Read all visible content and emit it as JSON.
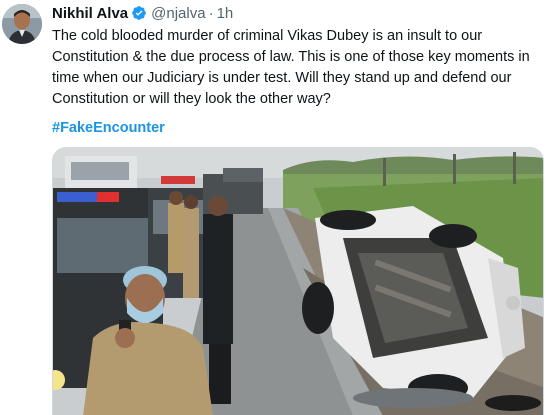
{
  "tweet": {
    "author_name": "Nikhil Alva",
    "handle": "@njalva",
    "separator": "·",
    "timestamp": "1h",
    "text": "The cold blooded murder of criminal Vikas Dubey is an insult to our Constitution & the due process of law. This is one of those key moments in time when our Judiciary is under test. Will they stand up and defend our Constitution or will they look the other way?",
    "hashtag": "#FakeEncounter"
  },
  "icons": {
    "verified": "verified-badge-icon"
  },
  "colors": {
    "link": "#1b95e0",
    "text": "#0f1419",
    "secondary": "#536471"
  }
}
